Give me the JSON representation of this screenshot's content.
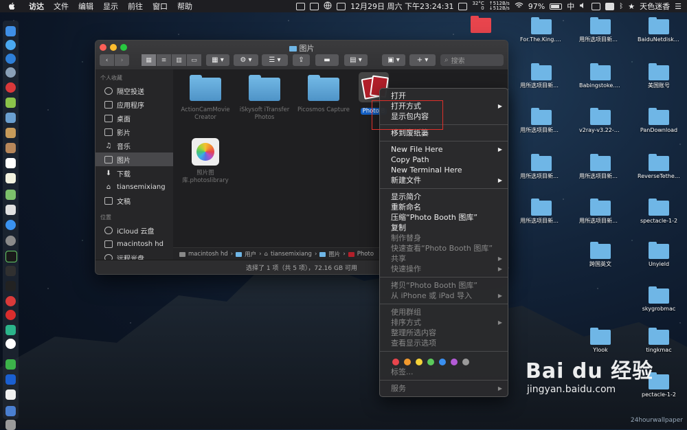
{
  "menubar": {
    "app": "访达",
    "menus": [
      "文件",
      "编辑",
      "显示",
      "前往",
      "窗口",
      "帮助"
    ],
    "datetime": "12月29日 周六 下午23:24:31",
    "temp": "32°C",
    "fan": "0",
    "net_up": "↑512B/s",
    "net_down": "↓512B/s",
    "battery": "97%",
    "input_method": "中",
    "user": "天色迷香"
  },
  "finder": {
    "title": "图片",
    "search_placeholder": "搜索",
    "sidebar": {
      "favorites_header": "个人收藏",
      "favorites": [
        "隔空投送",
        "应用程序",
        "桌面",
        "影片",
        "音乐",
        "图片",
        "下载",
        "tiansemixiang",
        "文稿"
      ],
      "active_index": 5,
      "locations_header": "位置",
      "locations": [
        "iCloud 云盘",
        "macintosh hd",
        "远程光盘"
      ]
    },
    "files": [
      {
        "name": "ActionCamMovie Creator"
      },
      {
        "name": "iSkysoft iTransfer Photos"
      },
      {
        "name": "Picosmos Capture"
      },
      {
        "name": "照片图库.photoslibrary"
      }
    ],
    "selected_file": "Photo B",
    "path": [
      "macintosh hd",
      "用户",
      "tiansemixiang",
      "图片",
      "Photo"
    ],
    "status": "选择了 1 项（共 5 项），72.16 GB 可用"
  },
  "context_menu": {
    "group1": [
      {
        "label": "打开",
        "submenu": false
      },
      {
        "label": "打开方式",
        "submenu": true
      },
      {
        "label": "显示包内容",
        "submenu": false
      }
    ],
    "group2": [
      {
        "label": "移到废纸篓",
        "submenu": false
      }
    ],
    "group3": [
      {
        "label": "New File Here",
        "submenu": true
      },
      {
        "label": "Copy Path",
        "submenu": false
      },
      {
        "label": "New Terminal Here",
        "submenu": false
      },
      {
        "label": "新建文件",
        "submenu": true
      }
    ],
    "group4": [
      {
        "label": "显示简介",
        "submenu": false
      },
      {
        "label": "重新命名",
        "submenu": false
      },
      {
        "label": "压缩“Photo Booth 图库”",
        "submenu": false
      },
      {
        "label": "复制",
        "submenu": false
      },
      {
        "label": "制作替身",
        "submenu": false
      },
      {
        "label": "快速查看“Photo Booth 图库”",
        "submenu": false
      },
      {
        "label": "共享",
        "submenu": true
      },
      {
        "label": "快速操作",
        "submenu": true
      }
    ],
    "group5": [
      {
        "label": "拷贝“Photo Booth 图库”",
        "submenu": false
      },
      {
        "label": "从 iPhone 或 iPad 导入",
        "submenu": true
      }
    ],
    "group6": [
      {
        "label": "使用群组",
        "submenu": false
      },
      {
        "label": "排序方式",
        "submenu": true
      },
      {
        "label": "整理所选内容",
        "submenu": false
      },
      {
        "label": "查看显示选项",
        "submenu": false
      }
    ],
    "tag_colors": [
      "#e8454d",
      "#f29a2e",
      "#f5d33a",
      "#5bc95b",
      "#3a8ff0",
      "#b35bd6",
      "#9a9a9a"
    ],
    "tags_label": "标签...",
    "services": "服务"
  },
  "desktop": {
    "items": [
      {
        "label": "For.The.King.MacOS...VATED"
      },
      {
        "label": "用所选项目新建的文件夹 14"
      },
      {
        "label": "BaiduNetdiskPlugin-ma...master"
      },
      {
        "label": "用所选项目新建的文件夹 10"
      },
      {
        "label": "Babingstoke.MACOSX-OGG"
      },
      {
        "label": "美国账号"
      },
      {
        "label": "用所选项目新建的文件夹 9"
      },
      {
        "label": "v2ray-v3.22-macos"
      },
      {
        "label": "PanDownload"
      },
      {
        "label": "用所选项目新建的文件夹 8"
      },
      {
        "label": "用所选项目新建的文件夹 13"
      },
      {
        "label": "ReverseTetheringServer_12.0"
      },
      {
        "label": "用所选项目新建的文件夹 7"
      },
      {
        "label": "用所选项目新建的文件夹 12"
      },
      {
        "label": "spectacle-1-2"
      },
      {
        "label": "跨国英文"
      },
      {
        "label": "Unyield"
      },
      {
        "label": "skygrobmac"
      },
      {
        "label": "tingkmac"
      },
      {
        "label": "Ylook"
      },
      {
        "label": "pectacle-1-2"
      },
      {
        "label": "24hourwallpaper"
      }
    ]
  },
  "watermark": {
    "logo": "Bai du 经验",
    "url": "jingyan.baidu.com"
  }
}
